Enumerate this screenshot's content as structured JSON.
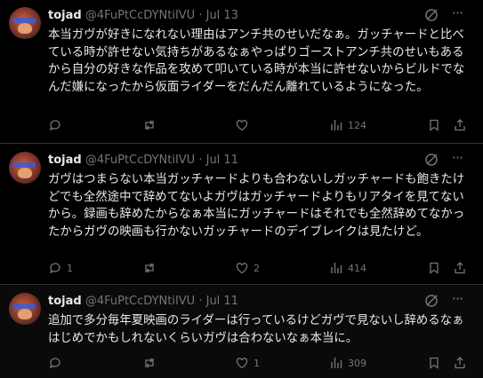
{
  "tweets": [
    {
      "name": "tojad",
      "handle": "@4FuPtCcDYNtiIVU",
      "dot": "·",
      "date": "Jul 13",
      "text": "本当ガヴが好きになれない理由はアンチ共のせいだなぁ。ガッチャードと比べている時が許せない気持ちがあるなぁやっぱりゴーストアンチ共のせいもあるから自分の好きな作品を攻めて叩いている時が本当に許せないからビルドでなんだ嫌になったから仮面ライダーをだんだん離れているようになった。",
      "replies": "",
      "retweets": "",
      "likes": "",
      "views": "124"
    },
    {
      "name": "tojad",
      "handle": "@4FuPtCcDYNtiIVU",
      "dot": "·",
      "date": "Jul 11",
      "text": "ガヴはつまらない本当ガッチャードよりも合わないしガッチャードも飽きたけどでも全然途中で辞めてないよガヴはガッチャードよりもリアタイを見てないから。録画も辞めたからなぁ本当にガッチャードはそれでも全然辞めてなかったからガヴの映画も行かないガッチャードのデイブレイクは見たけど。",
      "replies": "1",
      "retweets": "",
      "likes": "2",
      "views": "414"
    },
    {
      "name": "tojad",
      "handle": "@4FuPtCcDYNtiIVU",
      "dot": "·",
      "date": "Jul 11",
      "text": "追加で多分毎年夏映画のライダーは行っているけどガヴで見ないし辞めるなぁはじめでかもしれないくらいガヴは合わないなぁ本当に。",
      "replies": "",
      "retweets": "",
      "likes": "1",
      "views": "309"
    }
  ],
  "colors": {
    "background": "#000000",
    "text": "#e7e9ea",
    "muted": "#71767b",
    "divider": "#2f3336"
  },
  "icons": [
    "grok-icon",
    "more-icon",
    "reply-icon",
    "retweet-icon",
    "like-icon",
    "views-icon",
    "bookmark-icon",
    "share-icon"
  ]
}
